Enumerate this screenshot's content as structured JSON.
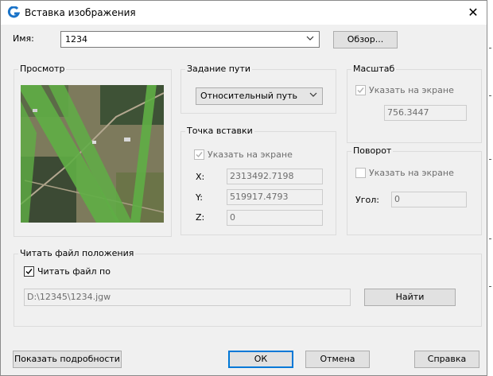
{
  "window": {
    "title": "Вставка изображения",
    "close_glyph": "✕"
  },
  "name_row": {
    "label": "Имя:",
    "value": "1234",
    "browse_label": "Обзор..."
  },
  "preview": {
    "title": "Просмотр"
  },
  "path": {
    "title": "Задание пути",
    "value": "Относительный путь"
  },
  "insertion_point": {
    "title": "Точка вставки",
    "on_screen_label": "Указать на экране",
    "x_label": "X:",
    "x_value": "2313492.7198",
    "y_label": "Y:",
    "y_value": "519917.4793",
    "z_label": "Z:",
    "z_value": "0"
  },
  "scale": {
    "title": "Масштаб",
    "on_screen_label": "Указать на экране",
    "value": "756.3447"
  },
  "rotation": {
    "title": "Поворот",
    "on_screen_label": "Указать на экране",
    "angle_label": "Угол:",
    "angle_value": "0"
  },
  "world_file": {
    "title": "Читать файл положения",
    "checkbox_label": "Читать файл по",
    "checked": true,
    "path_value": "D:\\12345\\1234.jgw",
    "find_label": "Найти"
  },
  "footer": {
    "details_label": "Показать подробности",
    "ok_label": "ОК",
    "cancel_label": "Отмена",
    "help_label": "Справка"
  },
  "colors": {
    "accent": "#0078d7",
    "dialog_bg": "#f0f0f0",
    "border": "#dcdcdc"
  }
}
